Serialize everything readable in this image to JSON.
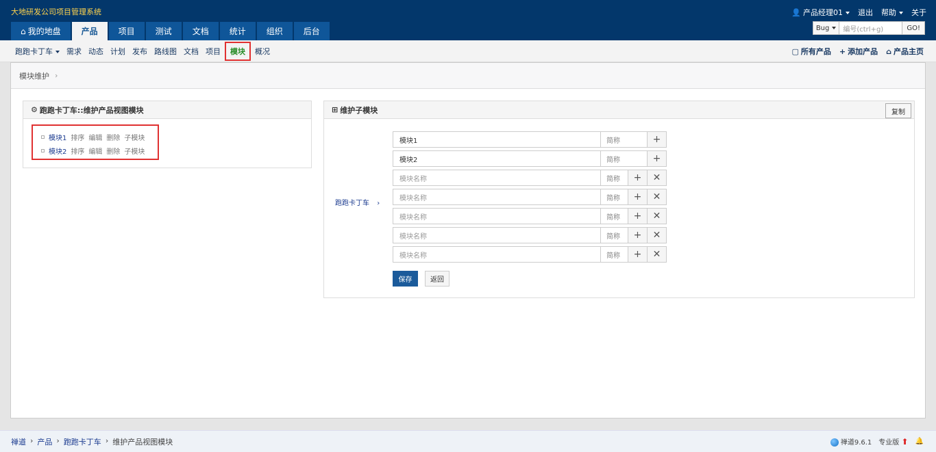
{
  "app": {
    "title": "大地研发公司项目管理系统"
  },
  "top_right": {
    "user": "产品经理01",
    "logout": "退出",
    "help": "帮助",
    "about": "关于"
  },
  "main_nav": [
    {
      "label": "我的地盘",
      "icon": "home-icon"
    },
    {
      "label": "产品"
    },
    {
      "label": "项目"
    },
    {
      "label": "测试"
    },
    {
      "label": "文档"
    },
    {
      "label": "统计"
    },
    {
      "label": "组织"
    },
    {
      "label": "后台"
    }
  ],
  "search": {
    "type": "Bug",
    "placeholder": "编号(ctrl+g)",
    "go": "GO!"
  },
  "subnav": {
    "product": "跑跑卡丁车",
    "items": [
      "需求",
      "动态",
      "计划",
      "发布",
      "路线图",
      "文档",
      "项目",
      "模块",
      "概况"
    ],
    "active": "模块",
    "right": [
      {
        "label": "所有产品",
        "icon": "cube-icon"
      },
      {
        "label": "添加产品",
        "icon": "plus-icon"
      },
      {
        "label": "产品主页",
        "icon": "home-icon"
      }
    ]
  },
  "breadcrumb": {
    "label": "模块维护"
  },
  "left_panel": {
    "title": "跑跑卡丁车::维护产品视图模块",
    "modules": [
      {
        "name": "模块1",
        "actions": [
          "排序",
          "编辑",
          "删除",
          "子模块"
        ]
      },
      {
        "name": "模块2",
        "actions": [
          "排序",
          "编辑",
          "删除",
          "子模块"
        ]
      }
    ]
  },
  "right_panel": {
    "title": "维护子模块",
    "copy_label": "复制",
    "parent": "跑跑卡丁车",
    "rows": [
      {
        "name": "模块1",
        "placeholder": "",
        "abbr": "简称",
        "removable": false
      },
      {
        "name": "模块2",
        "placeholder": "",
        "abbr": "简称",
        "removable": false
      },
      {
        "name": "",
        "placeholder": "模块名称",
        "abbr": "简称",
        "removable": true
      },
      {
        "name": "",
        "placeholder": "模块名称",
        "abbr": "简称",
        "removable": true
      },
      {
        "name": "",
        "placeholder": "模块名称",
        "abbr": "简称",
        "removable": true
      },
      {
        "name": "",
        "placeholder": "模块名称",
        "abbr": "简称",
        "removable": true
      },
      {
        "name": "",
        "placeholder": "模块名称",
        "abbr": "简称",
        "removable": true
      }
    ],
    "save_label": "保存",
    "back_label": "返回"
  },
  "footer": {
    "crumbs": [
      "禅道",
      "产品",
      "跑跑卡丁车",
      "维护产品视图模块"
    ],
    "version": "禅道9.6.1",
    "edition": "专业版"
  }
}
